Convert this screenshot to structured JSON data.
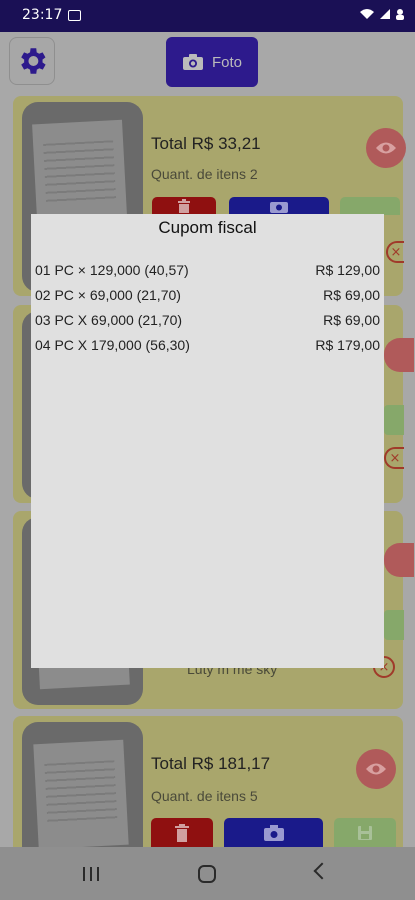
{
  "status_bar": {
    "time": "23:17"
  },
  "toolbar": {
    "foto_label": "Foto"
  },
  "cards": [
    {
      "total": "Total R$ 33,21",
      "quantity": "Quant. de itens 2"
    },
    {
      "total": "Total R$ 181,17",
      "quantity": "Quant. de itens 5"
    }
  ],
  "obscured_text": "Luty m me sky",
  "dialog": {
    "title": "Cupom fiscal",
    "rows": [
      {
        "desc": "01 PC × 129,000 (40,57)",
        "price": "R$ 129,00"
      },
      {
        "desc": "02 PC × 69,000 (21,70)",
        "price": "R$ 69,00"
      },
      {
        "desc": "03 PC X 69,000 (21,70)",
        "price": "R$ 69,00"
      },
      {
        "desc": "04 PC X 179,000 (56,30)",
        "price": "R$ 179,00"
      }
    ]
  },
  "colors": {
    "status_bar": "#1a1055",
    "primary_button": "#2d1a8c",
    "card_background": "#a9a66c",
    "delete_button": "#8f1010",
    "camera_button": "#1a1a8a",
    "save_button": "#86a86a",
    "eye_button": "#b05a5a",
    "dialog_background": "#e0e0e0"
  },
  "icons": [
    "gear-icon",
    "camera-icon",
    "eye-icon",
    "trash-icon",
    "save-icon",
    "close-icon",
    "image-icon",
    "wifi-icon",
    "signal-icon",
    "battery-icon"
  ]
}
